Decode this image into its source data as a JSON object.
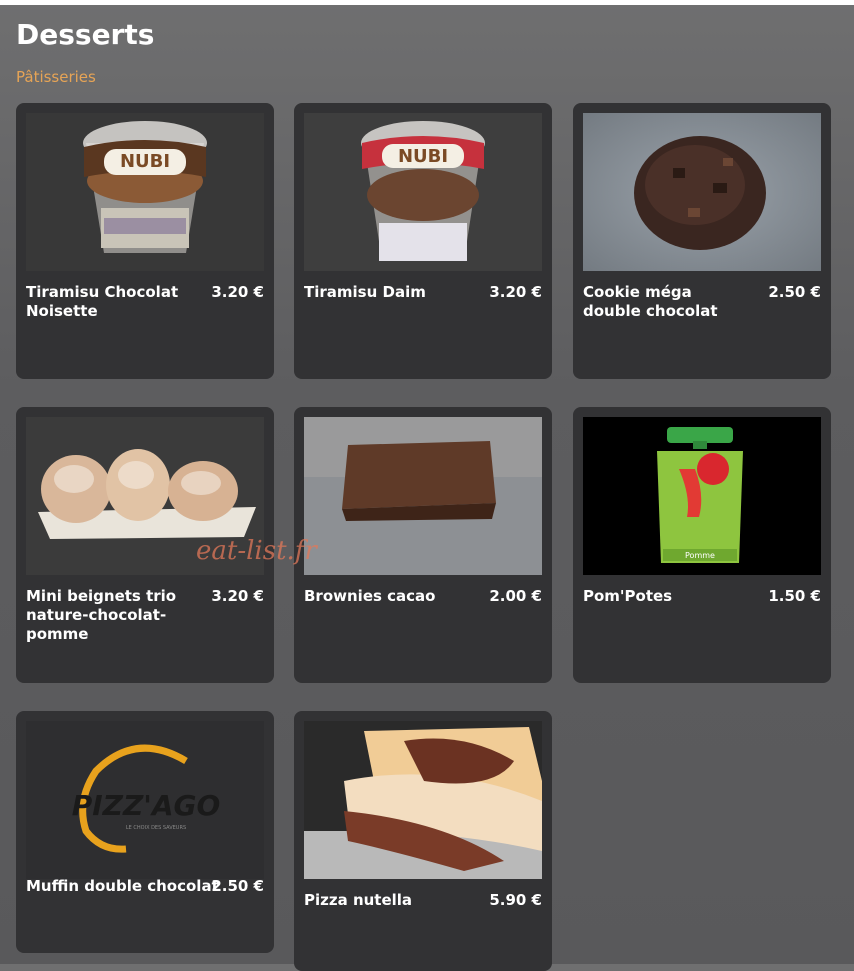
{
  "page": {
    "title": "Desserts",
    "section": "Pâtisseries",
    "watermark": "eat-list.fr"
  },
  "products": [
    {
      "name": "Tiramisu Chocolat Noisette",
      "price": "3.20 €",
      "image": "tiramisu-cup-nubi-brown"
    },
    {
      "name": "Tiramisu Daim",
      "price": "3.20 €",
      "image": "tiramisu-cup-nubi-red"
    },
    {
      "name": "Cookie méga double chocolat",
      "price": "2.50 €",
      "image": "chocolate-cookie"
    },
    {
      "name": "Mini beignets trio nature-chocolat-pomme",
      "price": "3.20 €",
      "image": "mini-donuts"
    },
    {
      "name": "Brownies cacao",
      "price": "2.00 €",
      "image": "brownie"
    },
    {
      "name": "Pom'Potes",
      "price": "1.50 €",
      "image": "pompotes-pouch"
    },
    {
      "name": "Muffin double chocolat",
      "price": "2.50 €",
      "image": "pizzago-logo"
    },
    {
      "name": "Pizza nutella",
      "price": "5.90 €",
      "image": "nutella-pizza"
    }
  ],
  "labels": {
    "nubi_brand": "NUBI",
    "nubi_tagline": "L'artisan gourmet",
    "pompotes_brand": "Pom'Potes",
    "pompotes_flavor": "Pomme",
    "pizzago_brand": "PIZZ'AGO",
    "pizzago_tagline": "LE CHOIX DES SAVEURS"
  },
  "colors": {
    "card_bg": "#323234",
    "section_accent": "#e6a456",
    "text": "#ffffff"
  }
}
